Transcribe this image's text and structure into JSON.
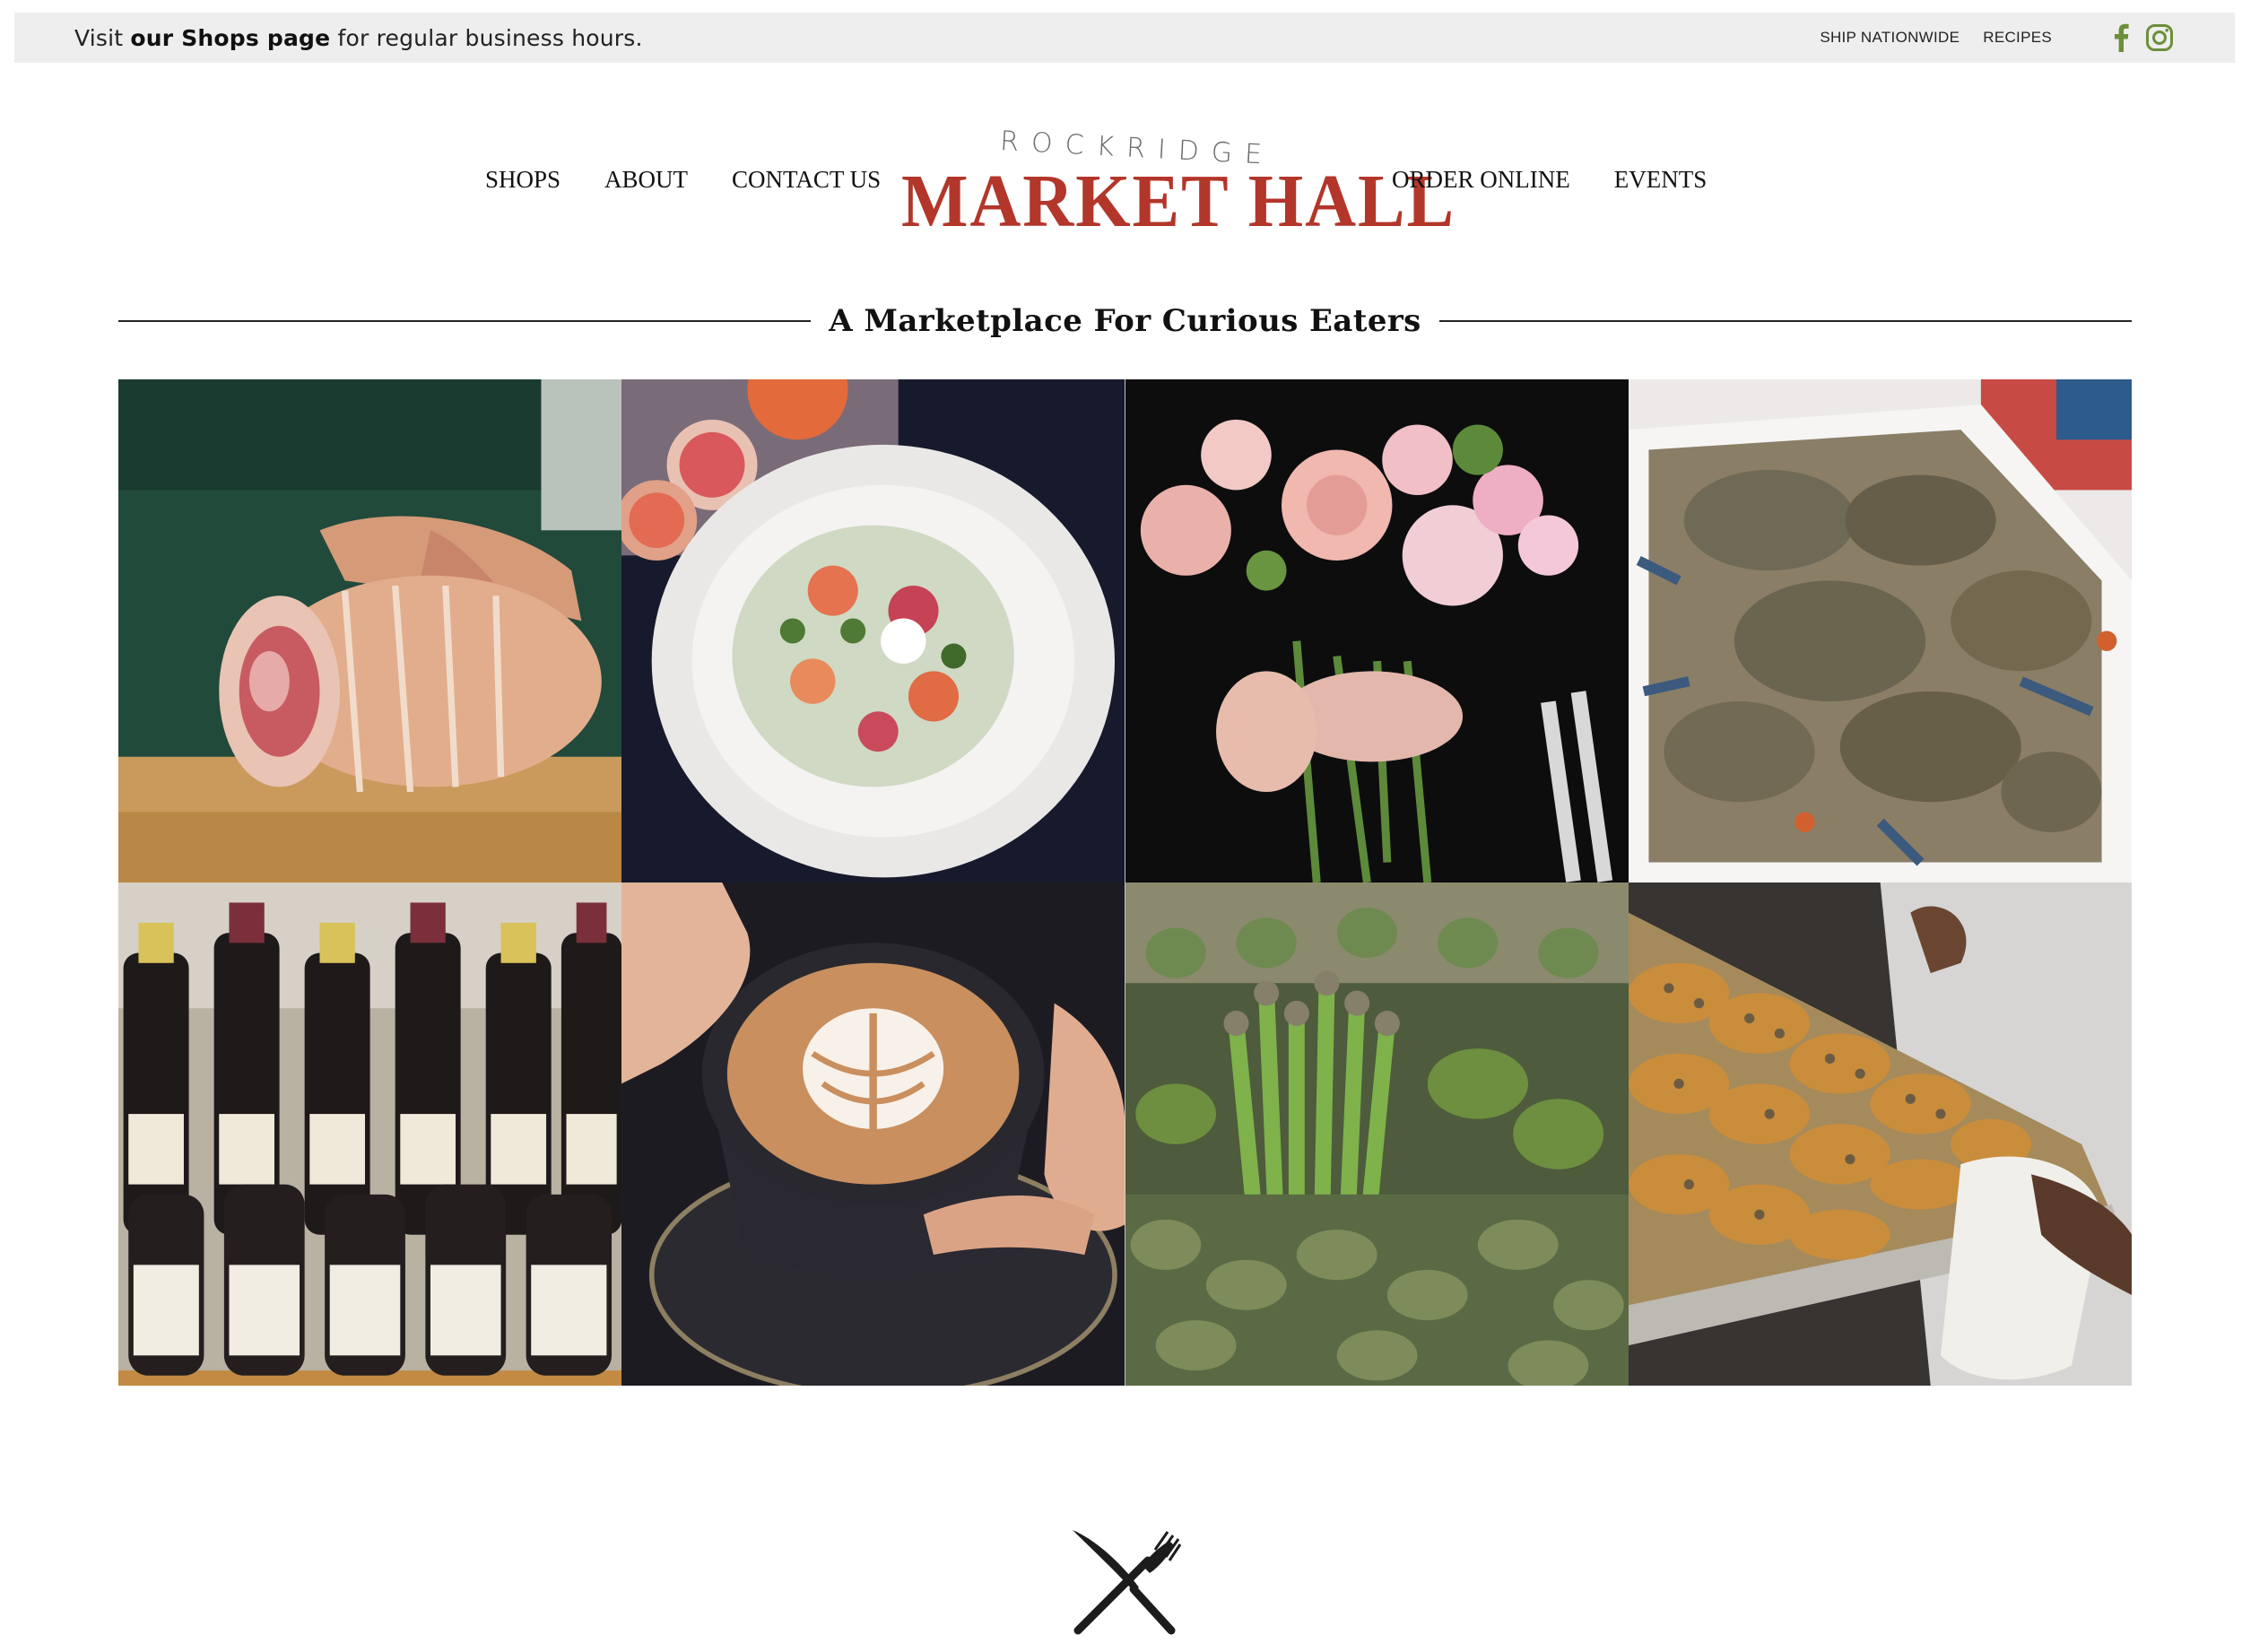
{
  "topbar": {
    "message_prefix": "Visit ",
    "message_link": "our Shops page",
    "message_suffix": " for regular business hours.",
    "links": [
      "SHIP NATIONWIDE",
      "RECIPES"
    ],
    "social_icons": [
      "facebook-icon",
      "instagram-icon"
    ],
    "accent_color": "#6c8f3a"
  },
  "nav": {
    "left": [
      "SHOPS",
      "ABOUT",
      "CONTACT US"
    ],
    "right": [
      "ORDER ONLINE",
      "EVENTS"
    ]
  },
  "logo": {
    "top": "ROCKRIDGE",
    "main": "MARKET HALL",
    "color": "#b3362a"
  },
  "tagline": "A Marketplace For Curious Eaters",
  "gallery": {
    "tiles": [
      "butcher-meat-photo",
      "citrus-salad-photo",
      "flower-bouquet-photo",
      "crabs-photo",
      "wine-bottles-photo",
      "latte-photo",
      "asparagus-photo",
      "bakery-tray-photo"
    ]
  },
  "footer_icon": "fork-knife-icon"
}
